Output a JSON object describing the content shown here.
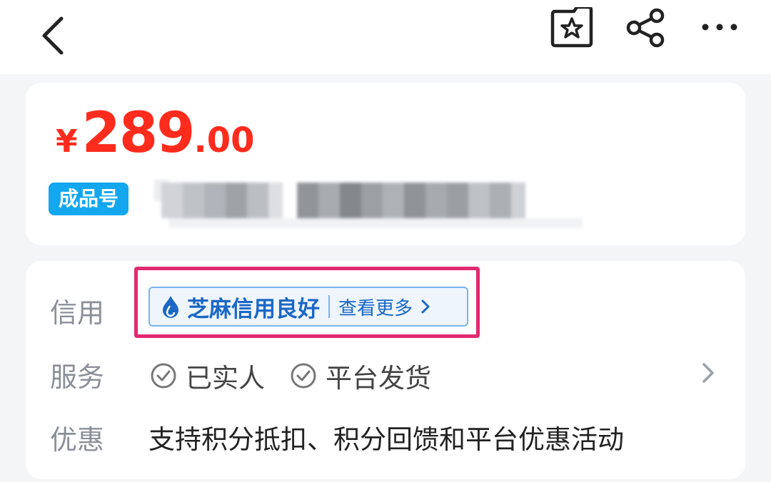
{
  "header": {
    "back_icon": "chevron-left-icon",
    "favorite_icon": "star-folder-icon",
    "share_icon": "share-icon",
    "more_icon": "more-dots-icon"
  },
  "price": {
    "currency": "¥",
    "integer": "289",
    "decimal": ".00",
    "color": "#ff2b1d"
  },
  "product": {
    "tag": "成品号",
    "tag_color": "#12a7ee"
  },
  "info": {
    "credit_label": "信用",
    "credit_badge": "芝麻信用良好",
    "credit_more": "查看更多",
    "service_label": "服务",
    "services": [
      "已实人",
      "平台发货"
    ],
    "promo_label": "优惠",
    "promo_text": "支持积分抵扣、积分回馈和平台优惠活动"
  },
  "colors": {
    "accent_blue": "#1a67c6",
    "highlight": "#e02a6f"
  }
}
